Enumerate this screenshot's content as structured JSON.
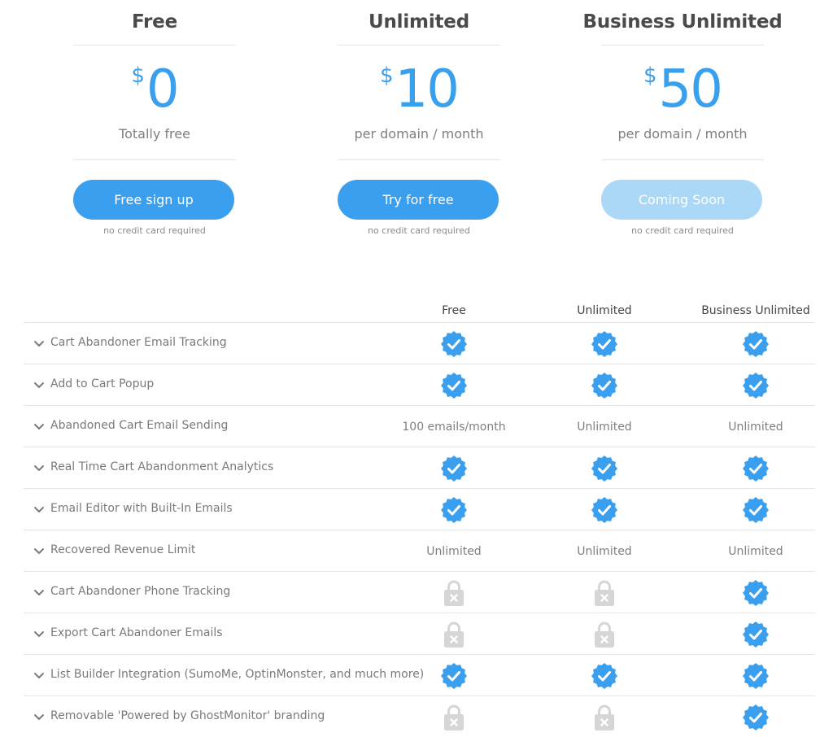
{
  "plans": [
    {
      "name": "Free",
      "currency": "$",
      "amount": "0",
      "period": "Totally free",
      "cta_label": "Free sign up",
      "note": "no credit card required"
    },
    {
      "name": "Unlimited",
      "currency": "$",
      "amount": "10",
      "period": "per domain / month",
      "cta_label": "Try for free",
      "note": "no credit card required"
    },
    {
      "name": "Business Unlimited",
      "currency": "$",
      "amount": "50",
      "period": "per domain / month",
      "cta_label": "Coming Soon",
      "note": "no credit card required"
    }
  ],
  "comparison": {
    "columns": [
      "Free",
      "Unlimited",
      "Business Unlimited"
    ],
    "rows": [
      {
        "feature": "Cart Abandoner Email Tracking",
        "values": [
          "check-icon",
          "check-icon",
          "check-icon"
        ]
      },
      {
        "feature": "Add to Cart Popup",
        "values": [
          "check-icon",
          "check-icon",
          "check-icon"
        ]
      },
      {
        "feature": "Abandoned Cart Email Sending",
        "values": [
          "100 emails/month",
          "Unlimited",
          "Unlimited"
        ]
      },
      {
        "feature": "Real Time Cart Abandonment Analytics",
        "values": [
          "check-icon",
          "check-icon",
          "check-icon"
        ]
      },
      {
        "feature": "Email Editor with Built-In Emails",
        "values": [
          "check-icon",
          "check-icon",
          "check-icon"
        ]
      },
      {
        "feature": "Recovered Revenue Limit",
        "values": [
          "Unlimited",
          "Unlimited",
          "Unlimited"
        ]
      },
      {
        "feature": "Cart Abandoner Phone Tracking",
        "values": [
          "lock-icon",
          "lock-icon",
          "check-icon"
        ]
      },
      {
        "feature": "Export Cart Abandoner Emails",
        "values": [
          "lock-icon",
          "lock-icon",
          "check-icon"
        ]
      },
      {
        "feature": "List Builder Integration (SumoMe, OptinMonster, and much more)",
        "values": [
          "check-icon",
          "check-icon",
          "check-icon"
        ]
      },
      {
        "feature": "Removable 'Powered by GhostMonitor' branding",
        "values": [
          "lock-icon",
          "lock-icon",
          "check-icon"
        ]
      }
    ]
  },
  "icons": {
    "row_toggle": "chevron-down-icon",
    "included": "check-icon",
    "locked": "lock-icon"
  },
  "colors": {
    "accent": "#3a9fee",
    "accent_disabled": "#acd8f8",
    "locked": "#d6d6d6"
  }
}
